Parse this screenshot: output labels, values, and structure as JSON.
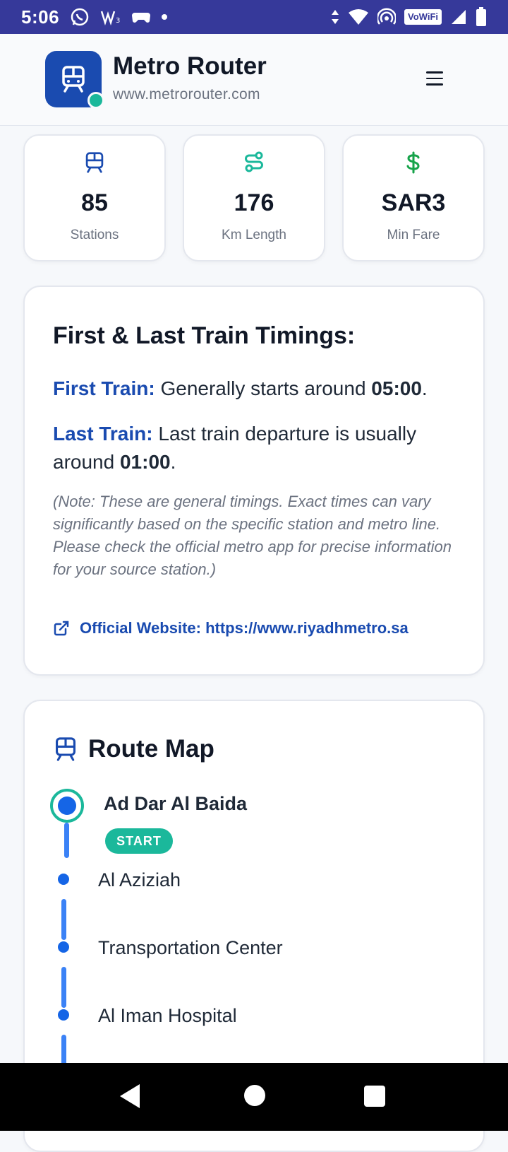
{
  "status_bar": {
    "time": "5:06",
    "wifi_label": "VoWiFi"
  },
  "header": {
    "title": "Metro Router",
    "url": "www.metrorouter.com"
  },
  "stats": [
    {
      "value": "85",
      "label": "Stations",
      "icon": "train-icon",
      "color": "#1a4bb0"
    },
    {
      "value": "176",
      "label": "Km Length",
      "icon": "route-icon",
      "color": "#1bb89b"
    },
    {
      "value": "SAR3",
      "label": "Min Fare",
      "icon": "dollar-icon",
      "color": "#16a34a"
    }
  ],
  "timings": {
    "title": "First & Last Train Timings:",
    "first_label": "First Train:",
    "first_text": " Generally starts around ",
    "first_time": "05:00",
    "last_label": "Last Train:",
    "last_text": " Last train departure is usually around ",
    "last_time": "01:00",
    "note": "(Note: These are general timings. Exact times can vary significantly based on the specific station and metro line. Please check the official metro app for precise information for your source station.)",
    "official_link": "Official Website: https://www.riyadhmetro.sa"
  },
  "route_map": {
    "title": "Route Map",
    "start_badge": "START",
    "stops": [
      "Ad Dar Al Baida",
      "Al Aziziah",
      "Transportation Center",
      "Al Iman Hospital"
    ]
  },
  "colors": {
    "primary": "#1a4bb0",
    "accent": "#1bb89b",
    "status_bar": "#36399a"
  }
}
